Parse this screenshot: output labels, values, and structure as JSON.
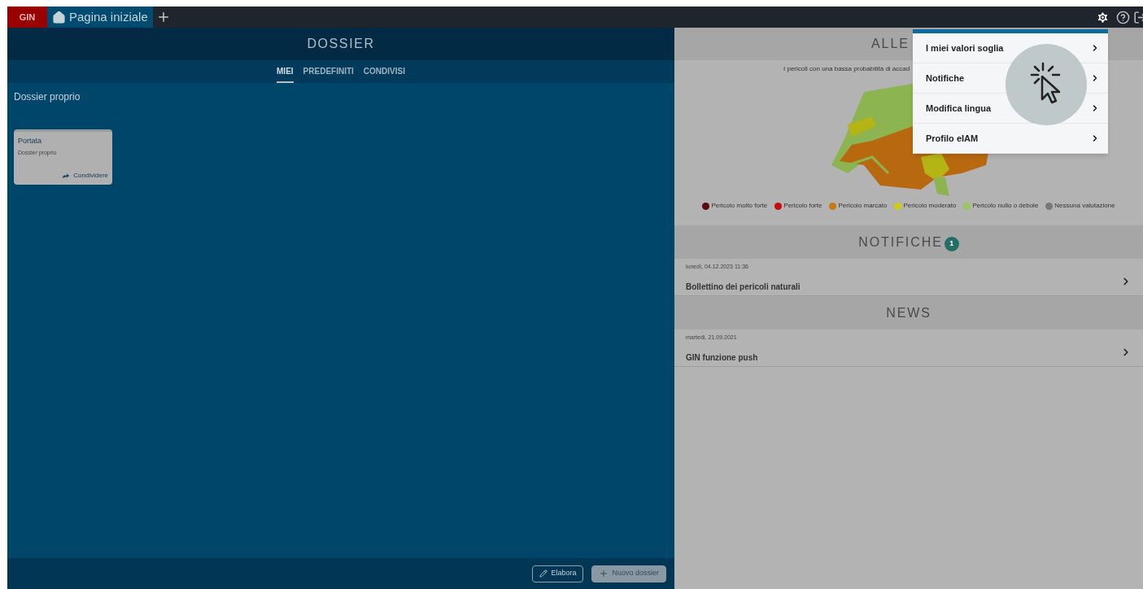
{
  "top_bar": {
    "brand": "GIN",
    "tabs": [
      {
        "label": "Pagina iniziale",
        "selected": true
      }
    ]
  },
  "dossier": {
    "title": "DOSSIER",
    "tabs": [
      {
        "label": "MIEI",
        "selected": true
      },
      {
        "label": "PREDEFINITI",
        "selected": false
      },
      {
        "label": "CONDIVISI",
        "selected": false
      }
    ],
    "section": "Dossier proprio",
    "cards": [
      {
        "title": "Portata",
        "subtitle": "Dossier proprio",
        "action": "Condividere"
      }
    ],
    "buttons": [
      {
        "label": "Elabora",
        "kind": "edit"
      },
      {
        "label": "Nuovo dossier",
        "kind": "add"
      }
    ]
  },
  "alerts": {
    "title": "ALLE",
    "description": "I pericoli con una bassa probabilità di accad",
    "legend": [
      {
        "label": "Pericolo molto forte",
        "color": "#5a0a0a"
      },
      {
        "label": "Pericolo forte",
        "color": "#c80a0a"
      },
      {
        "label": "Pericolo marcato",
        "color": "#c8780f"
      },
      {
        "label": "Pericolo moderato",
        "color": "#cccc14"
      },
      {
        "label": "Pericolo nullo o debole",
        "color": "#96c85a"
      },
      {
        "label": "Nessuna valutazione",
        "color": "#787878"
      }
    ]
  },
  "notifications": {
    "title": "NOTIFICHE",
    "badge": "1",
    "items": [
      {
        "date": "lunedì, 04.12.2023 11:36",
        "title": "Bollettino dei pericoli naturali"
      }
    ]
  },
  "news": {
    "title": "NEWS",
    "items": [
      {
        "date": "martedì, 21.09.2021",
        "title": "GIN funzione push"
      }
    ]
  },
  "settings_menu": {
    "items": [
      "I miei valori soglia",
      "Notifiche",
      "Modifica lingua",
      "Profilo eIAM"
    ]
  }
}
